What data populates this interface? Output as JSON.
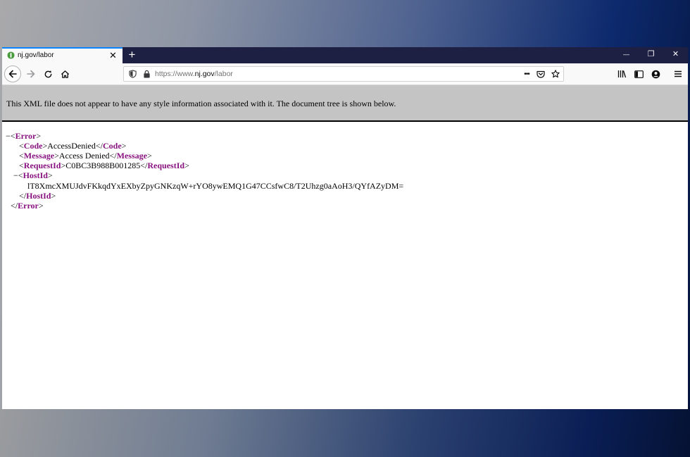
{
  "tab": {
    "title": "nj.gov/labor",
    "close_label": "✕",
    "new_tab_label": "+"
  },
  "window_controls": {
    "minimize": "—",
    "restore": "❐",
    "close": "✕"
  },
  "urlbar": {
    "scheme": "https://www.",
    "host": "nj.gov",
    "path": "/labor",
    "page_actions_label": "•••"
  },
  "icons": {
    "favicon": "site-favicon-icon",
    "back": "back-arrow-icon",
    "forward": "forward-arrow-icon",
    "reload": "reload-icon",
    "home": "home-icon",
    "tracking": "shield-icon",
    "lock": "lock-icon",
    "pocket": "pocket-icon",
    "bookmark": "star-icon",
    "library": "library-icon",
    "sidebar": "sidebar-icon",
    "account": "account-icon",
    "menu": "hamburger-menu-icon"
  },
  "colors": {
    "tab_strip": "#1d1f43",
    "accent": "#0a84ff",
    "xml_tag": "#881280",
    "xml_info_bg": "#c4c4c4"
  },
  "xml_info": {
    "message": "This XML file does not appear to have any style information associated with it. The document tree is shown below."
  },
  "xml": {
    "toggle": "−",
    "open_lt": "<",
    "close_lt": "</",
    "gt": ">",
    "error_tag": "Error",
    "code_tag": "Code",
    "code_value": "AccessDenied",
    "message_tag": "Message",
    "message_value": "Access Denied",
    "request_tag": "RequestId",
    "request_value": "C0BC3B988B001285",
    "host_tag": "HostId",
    "host_value": "lT8XmcXMUJdvFKkqdYxEXbyZpyGNKzqW+rYO8ywEMQ1G47CCsfwC8/T2Uhzg0aAoH3/QYfAZyDM="
  }
}
